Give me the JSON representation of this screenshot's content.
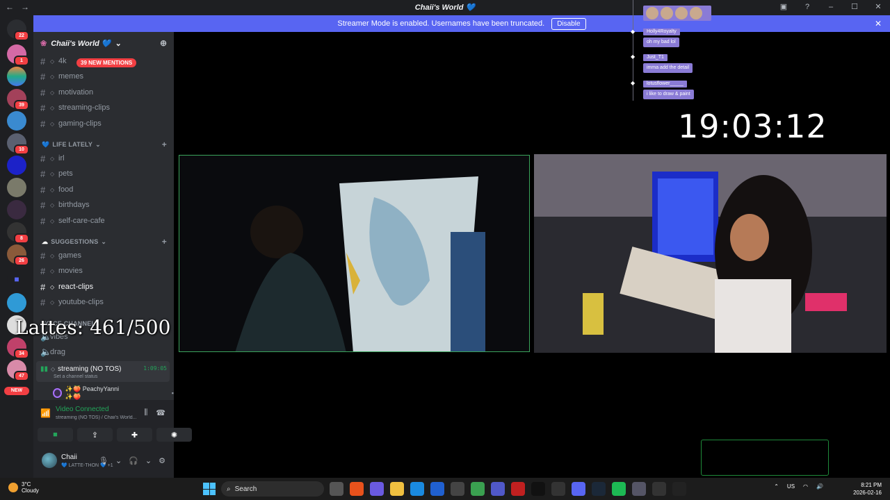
{
  "titlebar": {
    "title": "Chaii's World 💙",
    "back": "←",
    "forward": "→"
  },
  "banner": {
    "text": "Streamer Mode is enabled. Usernames have been truncated.",
    "disable": "Disable"
  },
  "rail": {
    "badges": [
      "22",
      "1",
      "39",
      "10",
      "8",
      "26",
      "34",
      "47"
    ],
    "new_label": "NEW"
  },
  "server": {
    "name": "Chaii's World 💙"
  },
  "mentions": "39 NEW MENTIONS",
  "channels_top": [
    "4k",
    "memes",
    "motivation",
    "streaming-clips",
    "gaming-clips"
  ],
  "categories": {
    "life": "LIFE LATELY",
    "suggestions": "SUGGESTIONS",
    "voice": "VOICE CHANNELS"
  },
  "channels_life": [
    "irl",
    "pets",
    "food",
    "birthdays",
    "self-care-cafe"
  ],
  "channels_suggest": [
    "games",
    "movies",
    "react-clips",
    "youtube-clips"
  ],
  "voice_channels": [
    "vibes",
    "drag",
    "streaming (NO TOS)"
  ],
  "voice_timer": "1:09:05",
  "status_line": "Set a channel status",
  "participant": "✨🍑 PeachyYanni ✨🍑",
  "overlay_text": "Lattes: 461/500",
  "voice_panel": {
    "title": "Video Connected",
    "sub": "streaming (NO TOS) / Chaii's World..."
  },
  "user": {
    "name": "Chaii",
    "status": "💙 LATTE-THON 💙 +1"
  },
  "clock": "19:03:12",
  "chat": [
    {
      "name": "Holly4Royalty",
      "msg": "oh my bad lol"
    },
    {
      "name": "Just_T1",
      "msg": "imma add the detail"
    },
    {
      "name": "lotusflower_____",
      "msg": "i like to draw & paint"
    }
  ],
  "taskbar": {
    "temp": "3°C",
    "weather": "Cloudy",
    "search": "Search",
    "lang": "US",
    "time": "8:21 PM",
    "date": "2026-02-16"
  }
}
